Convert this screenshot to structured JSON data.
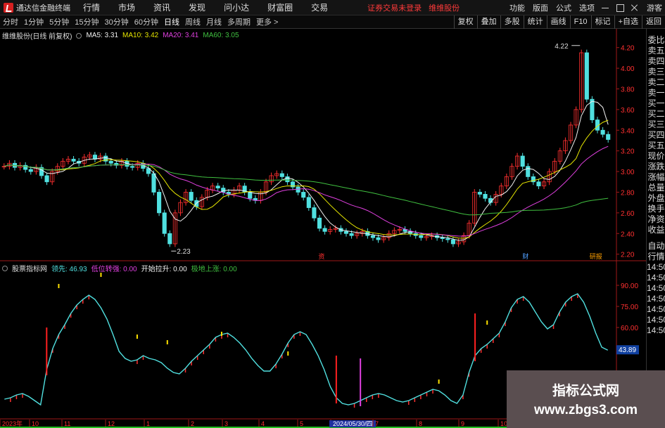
{
  "app": {
    "title": "通达信金融终端",
    "menu": [
      "行情",
      "市场",
      "资讯",
      "发现",
      "问小达",
      "财富圈",
      "交易"
    ],
    "notice": "证券交易未登录",
    "stock_link": "维维股份",
    "right_menu": [
      "功能",
      "版面",
      "公式",
      "选项"
    ],
    "guest": "游客"
  },
  "toolbar": {
    "periods": [
      "分时",
      "1分钟",
      "5分钟",
      "15分钟",
      "30分钟",
      "60分钟",
      "日线",
      "周线",
      "月线",
      "多周期",
      "更多 >"
    ],
    "active_period": "日线",
    "right_buttons": [
      "复权",
      "叠加",
      "多股",
      "统计",
      "画线",
      "F10",
      "标记",
      "+自选",
      "返回"
    ]
  },
  "main_chart": {
    "stock_name": "维维股份(日线 前复权)",
    "ma5": "MA5: 3.31",
    "ma10": "MA10: 3.42",
    "ma20": "MA20: 3.41",
    "ma60": "MA60: 3.05",
    "colors": {
      "ma5": "#f0f0f0",
      "ma10": "#e6e600",
      "ma20": "#e040e0",
      "ma60": "#40c040",
      "up": "#ff3030",
      "down": "#50e0e0"
    },
    "high_label": "4.22",
    "low_label": "2.23",
    "markers": [
      {
        "text": "资",
        "color": "#ff3030"
      },
      {
        "text": "财",
        "color": "#50a0ff"
      },
      {
        "text": "研报",
        "color": "#ffa000"
      }
    ]
  },
  "indicator": {
    "name": "股票指标网",
    "line1": "领先: 46.93",
    "line2": "低位转强: 0.00",
    "line3": "开始拉升: 0.00",
    "line4": "极地上涨: 0.00",
    "current_value": "43.89",
    "colors": {
      "line1": "#50e0e0",
      "line2": "#e040e0",
      "line3": "#f0f0f0",
      "line4": "#40c040"
    }
  },
  "x_axis": {
    "labels": [
      "2023年",
      "10",
      "11",
      "12",
      "1",
      "2",
      "3",
      "4",
      "5",
      "2024/05/30/四",
      "7",
      "8",
      "9",
      "10"
    ]
  },
  "right_panel": {
    "items": [
      "委比",
      "卖五",
      "卖四",
      "卖三",
      "卖二",
      "卖一",
      "买一",
      "买二",
      "买三",
      "买四",
      "买五",
      "现价",
      "涨跌",
      "涨幅",
      "总量",
      "外盘",
      "换手",
      "净资",
      "收益",
      "",
      "自动",
      "行情",
      "14:50",
      "14:50",
      "14:50",
      "14:50",
      "14:50",
      "14:50",
      "14:50"
    ]
  },
  "chart_data": [
    {
      "type": "candlestick",
      "title": "维维股份(日线 前复权)",
      "y_ticks": [
        "4.20",
        "4.00",
        "3.80",
        "3.60",
        "3.40",
        "3.20",
        "3.00",
        "2.80",
        "2.60",
        "2.40",
        "2.20"
      ],
      "ylim": [
        2.15,
        4.3
      ],
      "x_ticks": [
        "2023年",
        "10",
        "11",
        "12",
        "1",
        "2",
        "3",
        "4",
        "5",
        "2024/05/30/四",
        "7",
        "8",
        "9",
        "10"
      ],
      "close": [
        3.05,
        3.08,
        3.04,
        3.06,
        3.02,
        3.0,
        3.04,
        2.96,
        2.9,
        3.0,
        3.05,
        3.1,
        3.12,
        3.1,
        3.08,
        3.14,
        3.16,
        3.12,
        3.15,
        3.1,
        3.08,
        3.06,
        3.1,
        3.05,
        3.04,
        3.08,
        3.03,
        2.98,
        2.8,
        2.6,
        2.4,
        2.3,
        2.6,
        2.7,
        2.8,
        2.72,
        2.66,
        2.75,
        2.82,
        2.86,
        2.84,
        2.8,
        2.78,
        2.82,
        2.86,
        2.8,
        2.74,
        2.72,
        2.8,
        2.9,
        2.96,
        2.98,
        2.95,
        2.9,
        2.85,
        2.8,
        2.75,
        2.65,
        2.55,
        2.45,
        2.42,
        2.44,
        2.45,
        2.42,
        2.4,
        2.38,
        2.4,
        2.42,
        2.38,
        2.36,
        2.34,
        2.36,
        2.4,
        2.43,
        2.44,
        2.42,
        2.4,
        2.38,
        2.36,
        2.37,
        2.38,
        2.36,
        2.35,
        2.34,
        2.3,
        2.32,
        2.38,
        2.5,
        2.8,
        2.78,
        2.74,
        2.7,
        2.78,
        2.86,
        2.95,
        3.05,
        3.15,
        3.05,
        2.95,
        2.9,
        2.86,
        2.9,
        3.0,
        3.1,
        3.2,
        3.3,
        3.45,
        3.6,
        4.15,
        3.7,
        3.5,
        3.4,
        3.36,
        3.31
      ],
      "ma_values": {
        "MA5": 3.31,
        "MA10": 3.42,
        "MA20": 3.41,
        "MA60": 3.05
      },
      "annotations": [
        "4.22",
        "2.23"
      ]
    },
    {
      "type": "line",
      "title": "股票指标网",
      "y_ticks": [
        "90.00",
        "75.00",
        "60.00",
        "45.00"
      ],
      "ylim": [
        0,
        100
      ],
      "current_value": 43.89,
      "series": [
        {
          "name": "领先",
          "values": [
            9,
            10,
            12,
            13,
            11,
            8,
            5,
            30,
            45,
            55,
            62,
            70,
            76,
            80,
            83,
            80,
            74,
            66,
            55,
            43,
            38,
            36,
            37,
            40,
            38,
            37,
            35,
            31,
            28,
            27,
            31,
            36,
            40,
            44,
            48,
            53,
            55,
            56,
            53,
            49,
            44,
            38,
            33,
            29,
            29,
            34,
            41,
            49,
            55,
            57,
            55,
            48,
            40,
            30,
            18,
            10,
            6,
            5,
            6,
            8,
            10,
            12,
            13,
            12,
            10,
            8,
            7,
            8,
            10,
            12,
            14,
            16,
            15,
            12,
            8,
            6,
            12,
            28,
            40,
            45,
            48,
            52,
            56,
            64,
            74,
            80,
            82,
            78,
            71,
            64,
            59,
            62,
            71,
            78,
            82,
            84,
            78,
            68,
            56,
            46,
            43.89
          ]
        },
        {
          "name": "低位转强",
          "values": [
            0
          ]
        },
        {
          "name": "开始拉升",
          "values": [
            0
          ]
        },
        {
          "name": "极地上涨",
          "values": [
            0
          ]
        }
      ]
    }
  ]
}
